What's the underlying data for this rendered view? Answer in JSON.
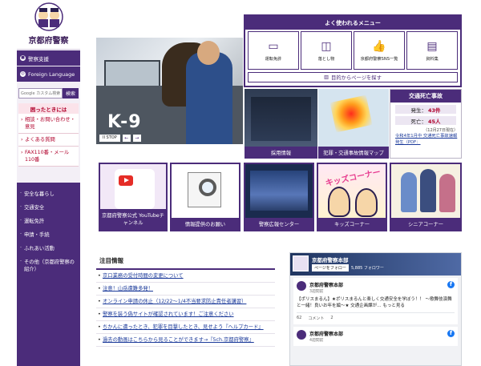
{
  "site": {
    "title": "京都府警察"
  },
  "sidebar": {
    "buttons": [
      {
        "label": "警察支援",
        "icon": "building-icon"
      },
      {
        "label": "Foreign Language",
        "icon": "globe-icon"
      }
    ],
    "search": {
      "placeholder": "Google カスタム検索",
      "button": "検索"
    },
    "help_title": "困ったときには",
    "help_items": [
      "相談・お問い合わせ・意見",
      "よくある質問",
      "FAX110番・メール110番"
    ],
    "nav_items": [
      "安全な暮らし",
      "交通安全",
      "運転免許",
      "申請・手続",
      "ふれあい活動",
      "その他（京都府警察の紹介）"
    ]
  },
  "hero": {
    "caption": "K-9",
    "stop_label": "II STOP",
    "prev": "←",
    "next": "→"
  },
  "menu": {
    "title": "よく使われるメニュー",
    "tiles": [
      {
        "label": "運転免許",
        "icon": "license-icon",
        "glyph": "▭"
      },
      {
        "label": "落とし物",
        "icon": "bag-icon",
        "glyph": "◫"
      },
      {
        "label": "京都府警察SNS一覧",
        "icon": "thumbs-up-icon",
        "glyph": "👍"
      },
      {
        "label": "資料集",
        "icon": "book-icon",
        "glyph": "▤"
      }
    ],
    "purpose": "目的からページを探す"
  },
  "cards": {
    "hire": "採用情報",
    "crimemap": "犯罪・交通事故情報マップ",
    "youtube": "京都府警察公式 YouTubeチャンネル",
    "info": "情報提供のお願い",
    "center": "警察広報センター",
    "kids_title": "キッズコーナー",
    "kids": "キッズコーナー",
    "senior": "シニアコーナー"
  },
  "accident": {
    "title": "交通死亡事故",
    "rows": [
      {
        "label": "発生：",
        "value": "43件"
      },
      {
        "label": "死亡：",
        "value": "45人"
      }
    ],
    "date": "（12月27日現在）",
    "note": "令和4年1月中 交通死亡事故速報発生（PDF："
  },
  "notice": {
    "title": "注目情報",
    "items": [
      "京口業務の受付時間の変更について",
      "注意！山岳遭難多発！",
      "オンライン申請の休止（12/22～1/4不当要求防止責任者講習）",
      "警察を装う偽サイトが確認されています！ご注意ください",
      "ちかんに遭ったとき、犯罪を目撃したとき、見せよう『ヘルプカード』",
      "過去の動画はこちらから見ることができます→『5ch.京都府警察』"
    ]
  },
  "facebook": {
    "page_name": "京都府警察本部",
    "follow": "ページをフォロー",
    "followers": "5,885 フォロワー",
    "posts": [
      {
        "name": "京都府警察本部",
        "time": "3週間前",
        "text": "【ポリスまるん】★ポリスまるんと楽しく交通安全を学ぼう！！ ～歌舞伎演舞と一緒！良いお年を編～★ 交通企画課が… もっと見る",
        "likes": "62",
        "comments": "コメント",
        "shares": "2"
      },
      {
        "name": "京都府警察本部",
        "time": "4週間前",
        "text": "",
        "likes": "",
        "comments": "",
        "shares": ""
      }
    ]
  }
}
